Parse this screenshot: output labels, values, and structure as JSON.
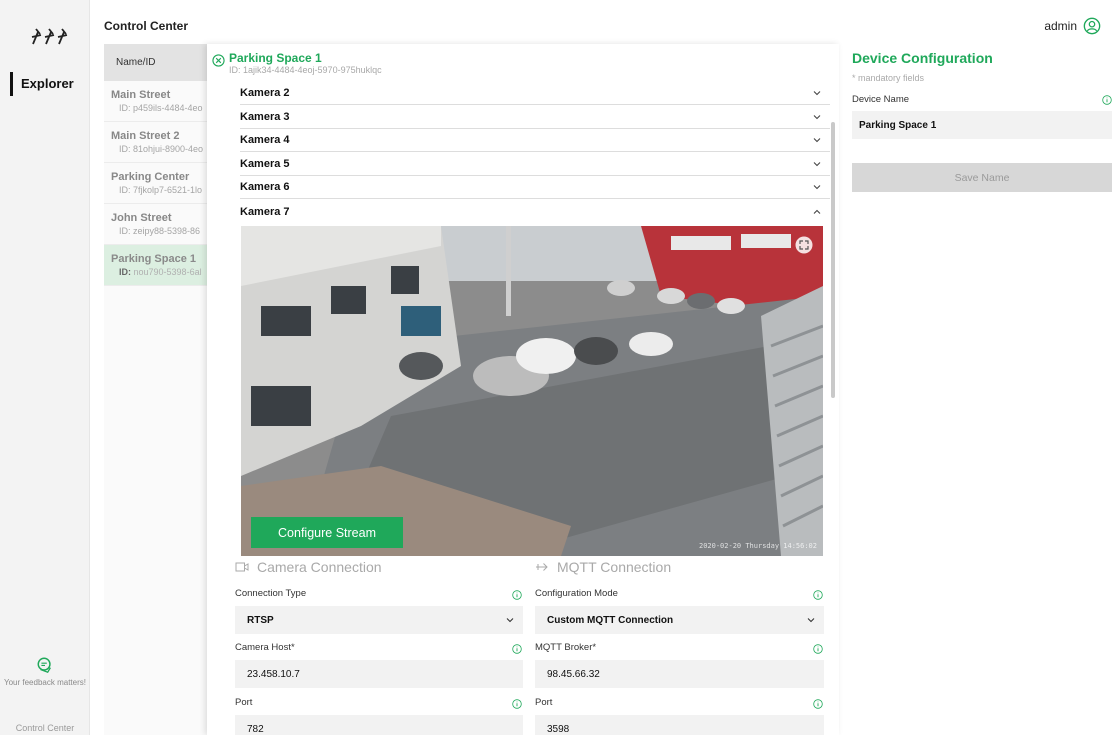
{
  "header": {
    "app_title": "Control Center",
    "user_name": "admin"
  },
  "rail": {
    "nav_label": "Explorer",
    "feedback_text": "Your feedback matters!",
    "footer_text": "Control Center"
  },
  "list": {
    "column_header": "Name/ID",
    "items": [
      {
        "name": "Main Street",
        "id": "ID: p459ils-4484-4eo"
      },
      {
        "name": "Main Street 2",
        "id": "ID: 81ohjui-8900-4eo"
      },
      {
        "name": "Parking Center",
        "id": "ID: 7fjkolp7-6521-1lo"
      },
      {
        "name": "John Street",
        "id": "ID: zeipy88-5398-86"
      },
      {
        "name": "Parking Space  1",
        "id_prefix": "ID:",
        "id": "nou790-5398-6al"
      }
    ]
  },
  "detail": {
    "title": "Parking Space 1",
    "id": "ID:  1ajik34-4484-4eoj-5970-975huklqc",
    "cameras": [
      "Kamera 2",
      "Kamera 3",
      "Kamera 4",
      "Kamera 5",
      "Kamera 6",
      "Kamera 7"
    ],
    "expanded_camera": "Kamera 7",
    "stream_timestamp": "2020-02-20 Thursday 14:56:02",
    "configure_button": "Configure Stream",
    "camera_section": {
      "title": "Camera Connection",
      "connection_type_label": "Connection Type",
      "connection_type_value": "RTSP",
      "host_label": "Camera Host*",
      "host_value": "23.458.10.7",
      "port_label": "Port",
      "port_value": "782"
    },
    "mqtt_section": {
      "title": "MQTT Connection",
      "mode_label": "Configuration Mode",
      "mode_value": "Custom MQTT Connection",
      "broker_label": "MQTT Broker*",
      "broker_value": "98.45.66.32",
      "port_label": "Port",
      "port_value": "3598"
    }
  },
  "config": {
    "title": "Device Configuration",
    "subtitle": "* mandatory fields",
    "name_label": "Device Name",
    "name_value": "Parking Space 1",
    "save_button": "Save Name"
  },
  "colors": {
    "accent": "#1fa85a",
    "active_row": "#dcefe1",
    "field_bg": "#f2f2f2"
  }
}
